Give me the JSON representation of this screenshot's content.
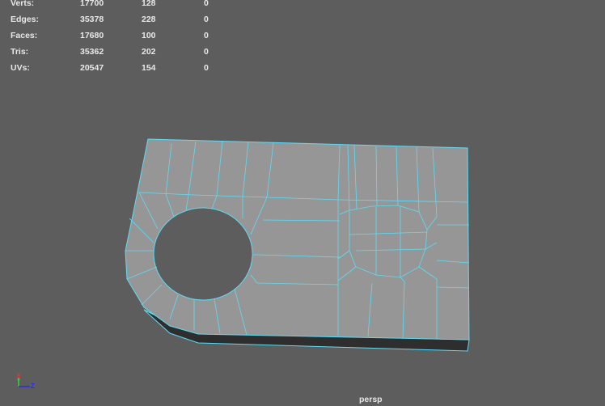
{
  "stats": [
    {
      "label": "Verts:",
      "total": "17700",
      "selected": "128",
      "extra": "0"
    },
    {
      "label": "Edges:",
      "total": "35378",
      "selected": "228",
      "extra": "0"
    },
    {
      "label": "Faces:",
      "total": "17680",
      "selected": "100",
      "extra": "0"
    },
    {
      "label": "Tris:",
      "total": "35362",
      "selected": "202",
      "extra": "0"
    },
    {
      "label": "UVs:",
      "total": "20547",
      "selected": "154",
      "extra": "0"
    }
  ],
  "camera": "persp",
  "axis": {
    "x": "X",
    "y": "Y",
    "z": "Z"
  },
  "colors": {
    "background": "#5d5d5d",
    "mesh": "#969696",
    "wire": "#5fdcf5",
    "side": "#2e2e2e"
  }
}
